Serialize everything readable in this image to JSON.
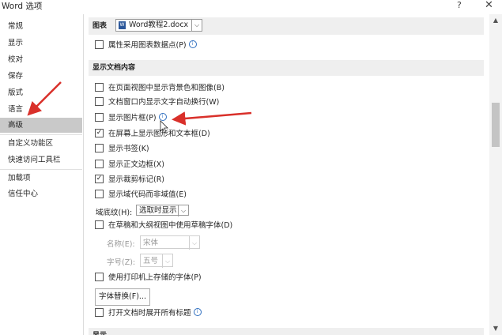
{
  "window": {
    "title": "Word 选项",
    "help_label": "?",
    "close_label": "✕"
  },
  "sidebar": {
    "items": [
      {
        "label": "常规"
      },
      {
        "label": "显示"
      },
      {
        "label": "校对"
      },
      {
        "label": "保存"
      },
      {
        "label": "版式"
      },
      {
        "label": "语言"
      },
      {
        "label": "高级"
      },
      {
        "label": "自定义功能区"
      },
      {
        "label": "快速访问工具栏"
      },
      {
        "label": "加载项"
      },
      {
        "label": "信任中心"
      }
    ],
    "active_index": 6
  },
  "chart_section": {
    "label": "图表",
    "document": "Word教程2.docx",
    "doc_icon": "word-document-icon",
    "property_checkbox": {
      "label": "属性采用图表数据点(P)",
      "checked": false
    }
  },
  "display_section": {
    "title": "显示文档内容",
    "options": [
      {
        "label": "在页面视图中显示背景色和图像(B)",
        "checked": false
      },
      {
        "label": "文档窗口内显示文字自动换行(W)",
        "checked": false
      },
      {
        "label": "显示图片框(P)",
        "checked": false
      },
      {
        "label": "在屏幕上显示图形和文本框(D)",
        "checked": true
      },
      {
        "label": "显示书签(K)",
        "checked": false
      },
      {
        "label": "显示正文边框(X)",
        "checked": false
      },
      {
        "label": "显示裁剪标记(R)",
        "checked": true
      },
      {
        "label": "显示域代码而非域值(E)",
        "checked": false
      }
    ],
    "field_shading_label": "域底纹(H):",
    "field_shading_value": "选取时显示",
    "draft_font_label": "在草稿和大纲视图中使用草稿字体(D)",
    "draft_font_checked": false,
    "font_name_label": "名称(E):",
    "font_name_value": "宋体",
    "font_size_label": "字号(Z):",
    "font_size_value": "五号",
    "printer_fonts_label": "使用打印机上存储的字体(P)",
    "printer_fonts_checked": false,
    "font_substitution_button": "字体替换(F)...",
    "expand_headings_label": "打开文档时展开所有标题",
    "expand_headings_checked": false,
    "next_section_title": "显示"
  },
  "icons": {
    "info": "info-icon",
    "checkmark": "✓",
    "chevron": "⌵",
    "arrow_up": "▲",
    "arrow_down": "▼",
    "info_glyph": "i"
  },
  "colors": {
    "accent_arrow": "#d9302a",
    "active_nav": "#c9c9c9",
    "section_bg": "#efefef",
    "info_blue": "#2f6fbf"
  }
}
